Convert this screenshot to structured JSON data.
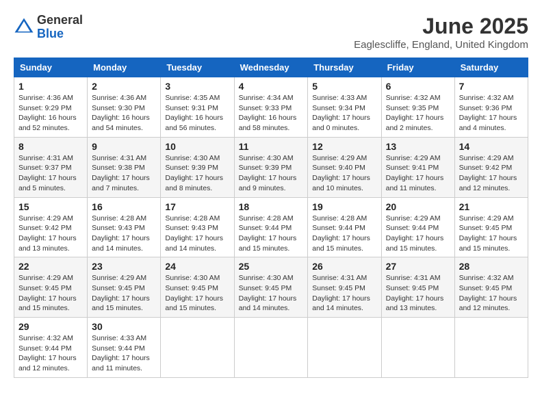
{
  "header": {
    "logo_line1": "General",
    "logo_line2": "Blue",
    "month": "June 2025",
    "location": "Eaglescliffe, England, United Kingdom"
  },
  "weekdays": [
    "Sunday",
    "Monday",
    "Tuesday",
    "Wednesday",
    "Thursday",
    "Friday",
    "Saturday"
  ],
  "weeks": [
    [
      {
        "day": "1",
        "sunrise": "Sunrise: 4:36 AM",
        "sunset": "Sunset: 9:29 PM",
        "daylight": "Daylight: 16 hours and 52 minutes."
      },
      {
        "day": "2",
        "sunrise": "Sunrise: 4:36 AM",
        "sunset": "Sunset: 9:30 PM",
        "daylight": "Daylight: 16 hours and 54 minutes."
      },
      {
        "day": "3",
        "sunrise": "Sunrise: 4:35 AM",
        "sunset": "Sunset: 9:31 PM",
        "daylight": "Daylight: 16 hours and 56 minutes."
      },
      {
        "day": "4",
        "sunrise": "Sunrise: 4:34 AM",
        "sunset": "Sunset: 9:33 PM",
        "daylight": "Daylight: 16 hours and 58 minutes."
      },
      {
        "day": "5",
        "sunrise": "Sunrise: 4:33 AM",
        "sunset": "Sunset: 9:34 PM",
        "daylight": "Daylight: 17 hours and 0 minutes."
      },
      {
        "day": "6",
        "sunrise": "Sunrise: 4:32 AM",
        "sunset": "Sunset: 9:35 PM",
        "daylight": "Daylight: 17 hours and 2 minutes."
      },
      {
        "day": "7",
        "sunrise": "Sunrise: 4:32 AM",
        "sunset": "Sunset: 9:36 PM",
        "daylight": "Daylight: 17 hours and 4 minutes."
      }
    ],
    [
      {
        "day": "8",
        "sunrise": "Sunrise: 4:31 AM",
        "sunset": "Sunset: 9:37 PM",
        "daylight": "Daylight: 17 hours and 5 minutes."
      },
      {
        "day": "9",
        "sunrise": "Sunrise: 4:31 AM",
        "sunset": "Sunset: 9:38 PM",
        "daylight": "Daylight: 17 hours and 7 minutes."
      },
      {
        "day": "10",
        "sunrise": "Sunrise: 4:30 AM",
        "sunset": "Sunset: 9:39 PM",
        "daylight": "Daylight: 17 hours and 8 minutes."
      },
      {
        "day": "11",
        "sunrise": "Sunrise: 4:30 AM",
        "sunset": "Sunset: 9:39 PM",
        "daylight": "Daylight: 17 hours and 9 minutes."
      },
      {
        "day": "12",
        "sunrise": "Sunrise: 4:29 AM",
        "sunset": "Sunset: 9:40 PM",
        "daylight": "Daylight: 17 hours and 10 minutes."
      },
      {
        "day": "13",
        "sunrise": "Sunrise: 4:29 AM",
        "sunset": "Sunset: 9:41 PM",
        "daylight": "Daylight: 17 hours and 11 minutes."
      },
      {
        "day": "14",
        "sunrise": "Sunrise: 4:29 AM",
        "sunset": "Sunset: 9:42 PM",
        "daylight": "Daylight: 17 hours and 12 minutes."
      }
    ],
    [
      {
        "day": "15",
        "sunrise": "Sunrise: 4:29 AM",
        "sunset": "Sunset: 9:42 PM",
        "daylight": "Daylight: 17 hours and 13 minutes."
      },
      {
        "day": "16",
        "sunrise": "Sunrise: 4:28 AM",
        "sunset": "Sunset: 9:43 PM",
        "daylight": "Daylight: 17 hours and 14 minutes."
      },
      {
        "day": "17",
        "sunrise": "Sunrise: 4:28 AM",
        "sunset": "Sunset: 9:43 PM",
        "daylight": "Daylight: 17 hours and 14 minutes."
      },
      {
        "day": "18",
        "sunrise": "Sunrise: 4:28 AM",
        "sunset": "Sunset: 9:44 PM",
        "daylight": "Daylight: 17 hours and 15 minutes."
      },
      {
        "day": "19",
        "sunrise": "Sunrise: 4:28 AM",
        "sunset": "Sunset: 9:44 PM",
        "daylight": "Daylight: 17 hours and 15 minutes."
      },
      {
        "day": "20",
        "sunrise": "Sunrise: 4:29 AM",
        "sunset": "Sunset: 9:44 PM",
        "daylight": "Daylight: 17 hours and 15 minutes."
      },
      {
        "day": "21",
        "sunrise": "Sunrise: 4:29 AM",
        "sunset": "Sunset: 9:45 PM",
        "daylight": "Daylight: 17 hours and 15 minutes."
      }
    ],
    [
      {
        "day": "22",
        "sunrise": "Sunrise: 4:29 AM",
        "sunset": "Sunset: 9:45 PM",
        "daylight": "Daylight: 17 hours and 15 minutes."
      },
      {
        "day": "23",
        "sunrise": "Sunrise: 4:29 AM",
        "sunset": "Sunset: 9:45 PM",
        "daylight": "Daylight: 17 hours and 15 minutes."
      },
      {
        "day": "24",
        "sunrise": "Sunrise: 4:30 AM",
        "sunset": "Sunset: 9:45 PM",
        "daylight": "Daylight: 17 hours and 15 minutes."
      },
      {
        "day": "25",
        "sunrise": "Sunrise: 4:30 AM",
        "sunset": "Sunset: 9:45 PM",
        "daylight": "Daylight: 17 hours and 14 minutes."
      },
      {
        "day": "26",
        "sunrise": "Sunrise: 4:31 AM",
        "sunset": "Sunset: 9:45 PM",
        "daylight": "Daylight: 17 hours and 14 minutes."
      },
      {
        "day": "27",
        "sunrise": "Sunrise: 4:31 AM",
        "sunset": "Sunset: 9:45 PM",
        "daylight": "Daylight: 17 hours and 13 minutes."
      },
      {
        "day": "28",
        "sunrise": "Sunrise: 4:32 AM",
        "sunset": "Sunset: 9:45 PM",
        "daylight": "Daylight: 17 hours and 12 minutes."
      }
    ],
    [
      {
        "day": "29",
        "sunrise": "Sunrise: 4:32 AM",
        "sunset": "Sunset: 9:44 PM",
        "daylight": "Daylight: 17 hours and 12 minutes."
      },
      {
        "day": "30",
        "sunrise": "Sunrise: 4:33 AM",
        "sunset": "Sunset: 9:44 PM",
        "daylight": "Daylight: 17 hours and 11 minutes."
      },
      null,
      null,
      null,
      null,
      null
    ]
  ]
}
